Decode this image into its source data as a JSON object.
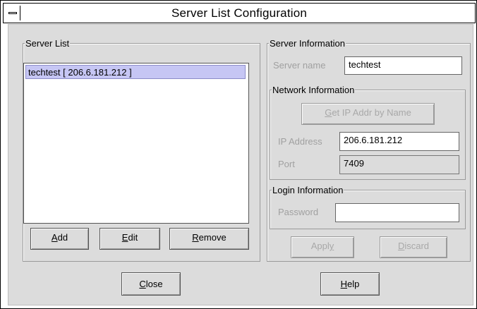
{
  "window": {
    "title": "Server List Configuration"
  },
  "server_list": {
    "legend": "Server List",
    "items": [
      "techtest  [ 206.6.181.212 ]"
    ],
    "buttons": {
      "add": "Add",
      "edit": "Edit",
      "remove": "Remove"
    }
  },
  "server_info": {
    "legend": "Server Information",
    "server_name_label": "Server name",
    "server_name_value": "techtest",
    "network": {
      "legend": "Network Information",
      "get_ip_button": "Get IP Addr by Name",
      "ip_label": "IP Address",
      "ip_value": "206.6.181.212",
      "port_label": "Port",
      "port_value": "7409"
    },
    "login": {
      "legend": "Login Information",
      "password_label": "Password",
      "password_value": ""
    },
    "apply_button": "Apply",
    "discard_button": "Discard"
  },
  "footer": {
    "close_button": "Close",
    "help_button": "Help"
  }
}
